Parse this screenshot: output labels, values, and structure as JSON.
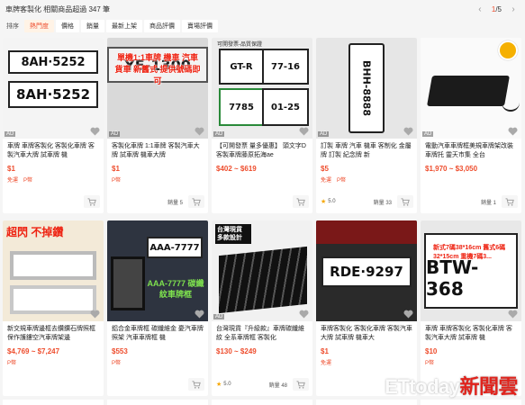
{
  "header": {
    "result_text": "車牌客製化 相關商品超過 347 筆",
    "page_current": "1",
    "page_total": "/5"
  },
  "sort": {
    "label": "排序",
    "options": [
      "熱門度",
      "價格",
      "銷量",
      "最新上架",
      "商品評價",
      "賣場評價"
    ]
  },
  "products": [
    {
      "title": "車牌 車牌客製化 客製化車牌 客製汽車大牌 試車牌 機",
      "price": "$1",
      "tags": [
        "免運",
        "P幣"
      ],
      "rating": "",
      "sold": "",
      "ad": "AD",
      "image_text": "8AH·5252"
    },
    {
      "title": "客製化車牌 1:1車牌 客製汽車大牌 試車牌 機車大牌",
      "price": "$1",
      "tags": [
        "P幣"
      ],
      "rating": "",
      "sold": "銷量 5",
      "ad": "AD",
      "image_text": "單機1:1車牌 機車 汽車 貨車 新舊式 提供號碼即可"
    },
    {
      "title": "【可開發票 量多優惠】 頭文字D客製車牌藤原拓海ae",
      "price": "$402 ~ $619",
      "tags": [],
      "rating": "",
      "sold": "",
      "ad": "AD",
      "image_text": "可開發票-品質保證"
    },
    {
      "title": "訂製 車牌 汽車 機車 客制化 金屬牌 訂製 紀念牌 新",
      "price": "$5",
      "tags": [
        "免運",
        "P幣"
      ],
      "rating": "5.0",
      "sold": "銷量 33",
      "ad": "AD",
      "image_text": "BHH-8888"
    },
    {
      "title": "電動汽車車牌框美規車牌架改裝車牌托 靈天市集 全台",
      "price": "$1,970 ~ $3,050",
      "tags": [],
      "rating": "",
      "sold": "銷量 1",
      "ad": "AD",
      "image_text": ""
    },
    {
      "title": "新交規車牌邊框去鑽鑽石牌照框保作護鏤空汽車牌架邊",
      "price": "$4,769 ~ $7,247",
      "tags": [
        "P幣"
      ],
      "rating": "",
      "sold": "",
      "ad": "",
      "image_text": "超閃 不掉鑽"
    },
    {
      "title": "鋁合金車牌框 碳纖維金 憂汽車牌照架 汽車車牌框 機",
      "price": "$553",
      "tags": [
        "P幣"
      ],
      "rating": "",
      "sold": "",
      "ad": "",
      "image_text": "AAA-7777 碳纖紋車牌框"
    },
    {
      "title": "台灣現貨『升級款』車牌碳纖維紋 全系車牌框 客製化",
      "price": "$130 ~ $249",
      "tags": [],
      "rating": "5.0",
      "sold": "銷量 48",
      "ad": "AD",
      "image_text": "台灣現貨 多款設計"
    },
    {
      "title": "車牌客製化 客製化車牌 客製汽車大牌 試車牌 機車大",
      "price": "$1",
      "tags": [
        "免運"
      ],
      "rating": "",
      "sold": "",
      "ad": "",
      "image_text": "RDE·9297"
    },
    {
      "title": "車牌 車牌客製化 客製化車牌 客製汽車大牌 試車牌 機",
      "price": "$10",
      "tags": [
        "P幣"
      ],
      "rating": "",
      "sold": "",
      "ad": "",
      "image_text": "新式7碼38*16cm 舊式6碼32*15cm 重機7碼3..."
    }
  ],
  "watermark": {
    "main": "ETtoday",
    "sub": "新聞雲"
  },
  "colors": {
    "accent": "#ee4d2d",
    "background": "#f5f5f5"
  }
}
